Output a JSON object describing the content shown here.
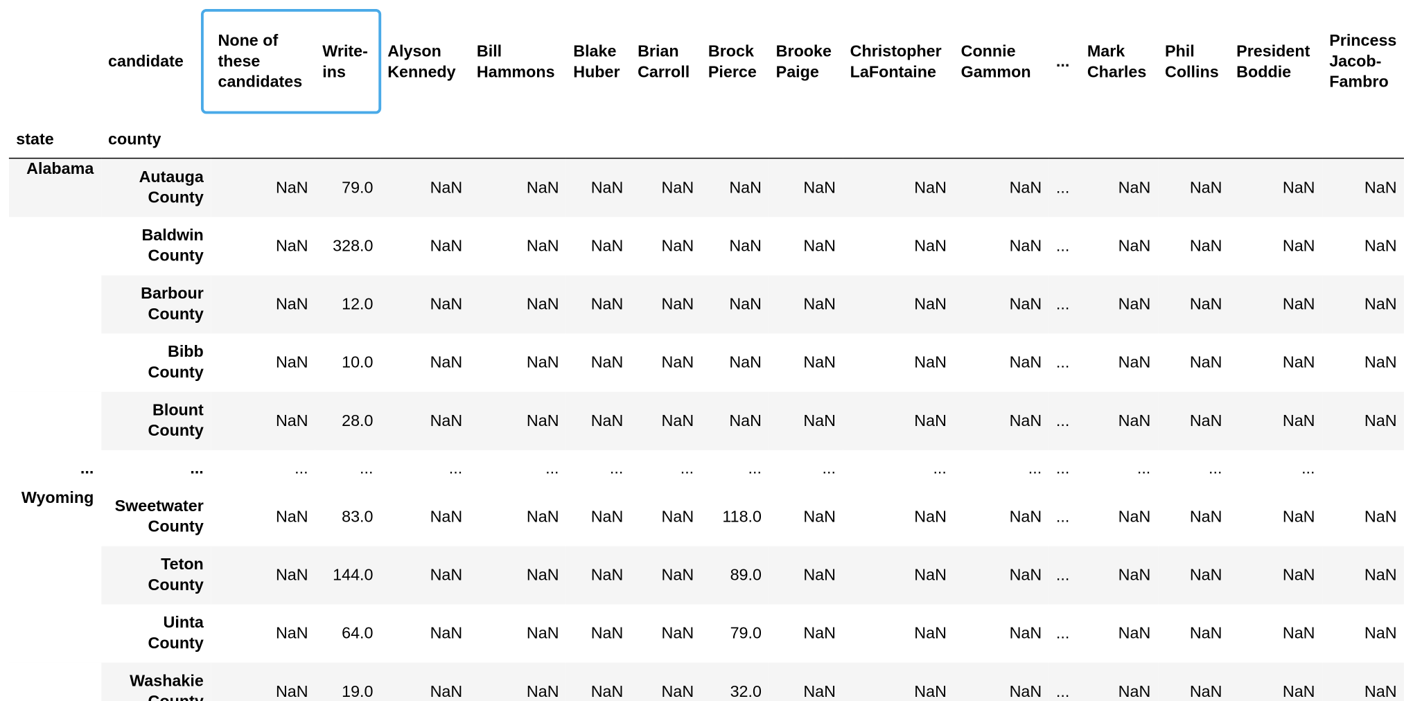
{
  "header": {
    "columns_level_name": "candidate",
    "index_names": [
      "state",
      "county"
    ],
    "columns": [
      "None of these candidates",
      "Write-ins",
      "Alyson Kennedy",
      "Bill Hammons",
      "Blake Huber",
      "Brian Carroll",
      "Brock Pierce",
      "Brooke Paige",
      "Christopher LaFontaine",
      "Connie Gammon",
      "...",
      "Mark Charles",
      "Phil Collins",
      "President Boddie",
      "Princess Jacob-Fambro"
    ]
  },
  "rows": [
    {
      "state": "Alabama",
      "county": "Autauga County",
      "values": [
        "NaN",
        "79.0",
        "NaN",
        "NaN",
        "NaN",
        "NaN",
        "NaN",
        "NaN",
        "NaN",
        "NaN",
        "...",
        "NaN",
        "NaN",
        "NaN",
        "NaN"
      ]
    },
    {
      "state": "",
      "county": "Baldwin County",
      "values": [
        "NaN",
        "328.0",
        "NaN",
        "NaN",
        "NaN",
        "NaN",
        "NaN",
        "NaN",
        "NaN",
        "NaN",
        "...",
        "NaN",
        "NaN",
        "NaN",
        "NaN"
      ]
    },
    {
      "state": "",
      "county": "Barbour County",
      "values": [
        "NaN",
        "12.0",
        "NaN",
        "NaN",
        "NaN",
        "NaN",
        "NaN",
        "NaN",
        "NaN",
        "NaN",
        "...",
        "NaN",
        "NaN",
        "NaN",
        "NaN"
      ]
    },
    {
      "state": "",
      "county": "Bibb County",
      "values": [
        "NaN",
        "10.0",
        "NaN",
        "NaN",
        "NaN",
        "NaN",
        "NaN",
        "NaN",
        "NaN",
        "NaN",
        "...",
        "NaN",
        "NaN",
        "NaN",
        "NaN"
      ]
    },
    {
      "state": "",
      "county": "Blount County",
      "values": [
        "NaN",
        "28.0",
        "NaN",
        "NaN",
        "NaN",
        "NaN",
        "NaN",
        "NaN",
        "NaN",
        "NaN",
        "...",
        "NaN",
        "NaN",
        "NaN",
        "NaN"
      ]
    },
    {
      "state": "...",
      "county": "...",
      "values": [
        "...",
        "...",
        "...",
        "...",
        "...",
        "...",
        "...",
        "...",
        "...",
        "...",
        "...",
        "...",
        "...",
        "...",
        ""
      ],
      "ellipsis": true
    },
    {
      "state": "Wyoming",
      "county": "Sweetwater County",
      "values": [
        "NaN",
        "83.0",
        "NaN",
        "NaN",
        "NaN",
        "NaN",
        "118.0",
        "NaN",
        "NaN",
        "NaN",
        "...",
        "NaN",
        "NaN",
        "NaN",
        "NaN"
      ]
    },
    {
      "state": "",
      "county": "Teton County",
      "values": [
        "NaN",
        "144.0",
        "NaN",
        "NaN",
        "NaN",
        "NaN",
        "89.0",
        "NaN",
        "NaN",
        "NaN",
        "...",
        "NaN",
        "NaN",
        "NaN",
        "NaN"
      ]
    },
    {
      "state": "",
      "county": "Uinta County",
      "values": [
        "NaN",
        "64.0",
        "NaN",
        "NaN",
        "NaN",
        "NaN",
        "79.0",
        "NaN",
        "NaN",
        "NaN",
        "...",
        "NaN",
        "NaN",
        "NaN",
        "NaN"
      ]
    },
    {
      "state": "",
      "county": "Washakie County",
      "values": [
        "NaN",
        "19.0",
        "NaN",
        "NaN",
        "NaN",
        "NaN",
        "32.0",
        "NaN",
        "NaN",
        "NaN",
        "...",
        "NaN",
        "NaN",
        "NaN",
        "NaN"
      ]
    }
  ],
  "highlight_color": "#4aaae8"
}
